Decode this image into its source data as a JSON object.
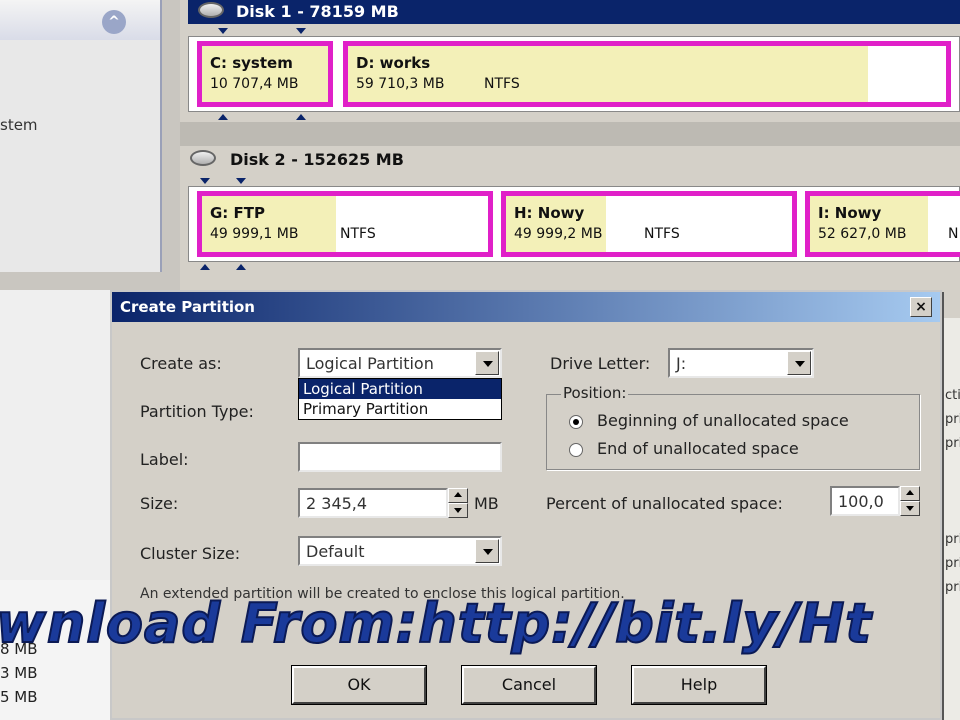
{
  "left_panel": {
    "partial_text": "stem",
    "bottom_sizes": [
      "8 MB",
      "3 MB",
      "5 MB"
    ]
  },
  "disk1": {
    "title": "Disk 1 - 78159 MB",
    "partitions": [
      {
        "name": "C:  system",
        "size": "10 707,4 MB",
        "fs": ""
      },
      {
        "name": "D:  works",
        "size": "59 710,3 MB",
        "fs": "NTFS"
      }
    ]
  },
  "disk2": {
    "title": "Disk 2 - 152625 MB",
    "partitions": [
      {
        "name": "G:  FTP",
        "size": "49 999,1 MB",
        "fs": "NTFS"
      },
      {
        "name": "H:  Nowy",
        "size": "49 999,2 MB",
        "fs": "NTFS"
      },
      {
        "name": "I:  Nowy",
        "size": "52 627,0 MB",
        "fs": "N"
      }
    ]
  },
  "dialog": {
    "title": "Create Partition",
    "close": "×",
    "create_as_label": "Create as:",
    "create_as_value": "Logical Partition",
    "create_as_options": [
      "Logical Partition",
      "Primary Partition"
    ],
    "partition_type_label": "Partition Type:",
    "label_label": "Label:",
    "label_value": "",
    "size_label": "Size:",
    "size_value": "2 345,4",
    "size_unit": "MB",
    "cluster_label": "Cluster Size:",
    "cluster_value": "Default",
    "drive_letter_label": "Drive Letter:",
    "drive_letter_value": "J:",
    "position_legend": "Position:",
    "position_options": [
      "Beginning of unallocated space",
      "End of unallocated space"
    ],
    "position_selected": 0,
    "percent_label": "Percent of unallocated space:",
    "percent_value": "100,0",
    "note": "An extended partition will be created to enclose this logical partition.",
    "ok": "OK",
    "cancel": "Cancel",
    "help": "Help"
  },
  "right_strip_text": [
    "cti",
    "pri",
    "pri",
    "pri",
    "pri",
    "pri"
  ],
  "banner": "wnload From:http://bit.ly/Ht",
  "colors": {
    "partition_border": "#e020c8",
    "used_fill": "#f3f0b8",
    "title_blue": "#0a246a",
    "banner_blue": "#1a3a9a",
    "banner_green": "#2a9a3a"
  }
}
